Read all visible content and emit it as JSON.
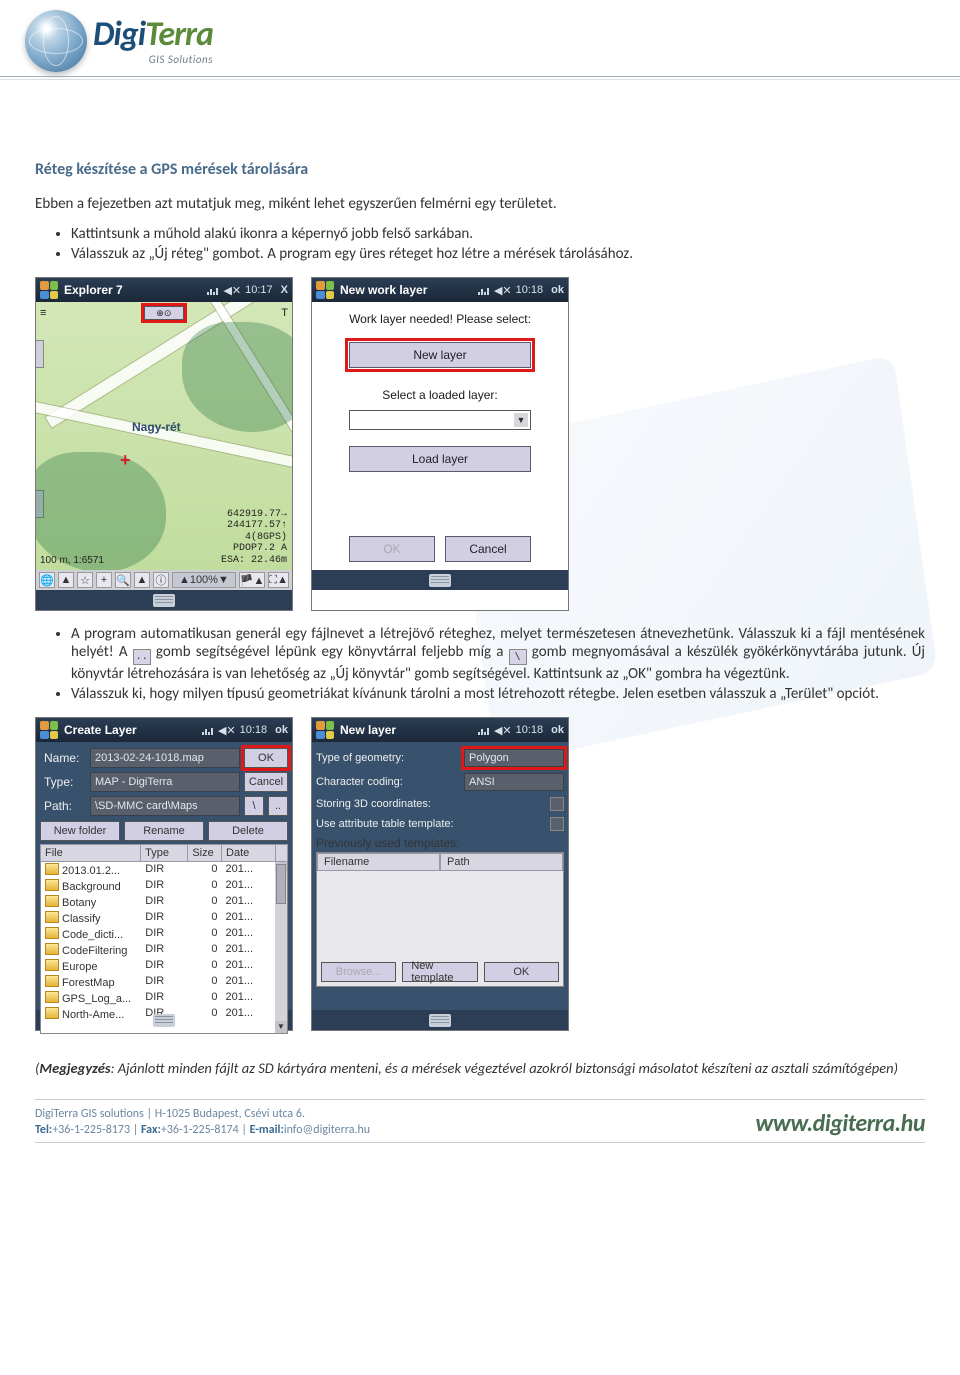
{
  "logo": {
    "brand_a": "Digi",
    "brand_b": "Terra",
    "tagline": "GIS Solutions"
  },
  "title": "Réteg készítése a GPS mérések tárolására",
  "intro": "Ebben a fejezetben azt mutatjuk meg, miként lehet egyszerűen felmérni egy területet.",
  "bullets_a": [
    "Kattintsunk a műhold alakú ikonra a képernyő jobb felső sarkában.",
    "Válasszuk az „Új réteg\" gombot. A program egy üres réteget hoz létre a mérések tárolásához."
  ],
  "shot1": {
    "title": "Explorer 7",
    "time": "10:17",
    "close": "X",
    "hud_left": "≡",
    "sat_btn": "⊕⊙",
    "hud_right": "T",
    "map_label": "Nagy-rét",
    "coords": [
      "642919.77→",
      "244177.57↑",
      "4(8GPS)",
      "PDOP7.2 A",
      "ESA: 22.46m"
    ],
    "scale": "100 m, 1:6571",
    "zoom": "▲100%▼",
    "toolbar": [
      "🌐",
      "▲",
      "☆",
      "+",
      "🔍",
      "▲",
      "ⓘ",
      "🏴▲",
      "⛶▲"
    ]
  },
  "shot2": {
    "title": "New work layer",
    "time": "10:18",
    "ok": "ok",
    "l1": "Work layer needed! Please select:",
    "new_layer": "New layer",
    "l2": "Select a loaded layer:",
    "load_layer": "Load layer",
    "btn_ok": "OK",
    "btn_cancel": "Cancel"
  },
  "para_b_pre": "A program automatikusan generál egy fájlnevet a létrejövő réteghez, melyet természetesen átnevezhetünk. Válasszuk ki a fájl mentésének helyét! A ",
  "para_b_mid1": " gomb segítségével lépünk egy könyvtárral feljebb míg a ",
  "para_b_mid2": " gomb megnyomásával a készülék gyökérkönyvtárába jutunk. Új könyvtár létrehozására is van lehetőség az „Új könyvtár\" gomb segítségével. Kattintsunk az „OK\" gombra ha végeztünk.",
  "bullet_b2": "Válasszuk ki, hogy milyen típusú geometriákat kívánunk tárolni a most létrehozott rétegbe. Jelen esetben válasszuk a „Terület\" opciót.",
  "icon_up": "..",
  "icon_root": "\\",
  "shot3": {
    "title": "Create Layer",
    "time": "10:18",
    "ok": "ok",
    "rows": {
      "name_lbl": "Name:",
      "name_val": "2013-02-24-1018.map",
      "name_ok": "OK",
      "type_lbl": "Type:",
      "type_val": "MAP - DigiTerra",
      "type_cancel": "Cancel",
      "path_lbl": "Path:",
      "path_val": "\\SD-MMC card\\Maps",
      "nav_root": "\\",
      "nav_up": ".."
    },
    "btns": [
      "New folder",
      "Rename",
      "Delete"
    ],
    "cols": [
      "File",
      "Type",
      "Size",
      "Date"
    ],
    "files": [
      {
        "n": "2013.01.2...",
        "t": "DIR",
        "s": "0",
        "d": "201..."
      },
      {
        "n": "Background",
        "t": "DIR",
        "s": "0",
        "d": "201..."
      },
      {
        "n": "Botany",
        "t": "DIR",
        "s": "0",
        "d": "201..."
      },
      {
        "n": "Classify",
        "t": "DIR",
        "s": "0",
        "d": "201..."
      },
      {
        "n": "Code_dicti...",
        "t": "DIR",
        "s": "0",
        "d": "201..."
      },
      {
        "n": "CodeFiltering",
        "t": "DIR",
        "s": "0",
        "d": "201..."
      },
      {
        "n": "Europe",
        "t": "DIR",
        "s": "0",
        "d": "201..."
      },
      {
        "n": "ForestMap",
        "t": "DIR",
        "s": "0",
        "d": "201..."
      },
      {
        "n": "GPS_Log_a...",
        "t": "DIR",
        "s": "0",
        "d": "201..."
      },
      {
        "n": "North-Ame...",
        "t": "DIR",
        "s": "0",
        "d": "201..."
      }
    ]
  },
  "shot4": {
    "title": "New layer",
    "time": "10:18",
    "ok": "ok",
    "geom_lbl": "Type of geometry:",
    "geom_val": "Polygon",
    "enc_lbl": "Character coding:",
    "enc_val": "ANSI",
    "store3d": "Storing 3D coordinates:",
    "useattr": "Use attribute table template:",
    "prev": "Previously used templates:",
    "tmpl_cols": [
      "Filename",
      "Path"
    ],
    "btns": [
      "Browse...",
      "New template",
      "OK"
    ]
  },
  "note_label": "Megjegyzés",
  "note_body": "(",
  "note_text": ": Ajánlott minden fájlt az SD kártyára menteni, és a mérések végeztével azokról biztonsági másolatot készíteni az asztali számítógépen)",
  "footer": {
    "line1": "DigiTerra  GIS  solutions        |        H-1025  Budapest,  Csévi  utca  6.",
    "tel_l": "Tel:",
    "tel": "+36-1-225-8173",
    "fax_l": "Fax:",
    "fax": "+36-1-225-8174",
    "mail_l": "E-mail:",
    "mail": "info@digiterra.hu",
    "url": "www.digiterra.hu"
  }
}
